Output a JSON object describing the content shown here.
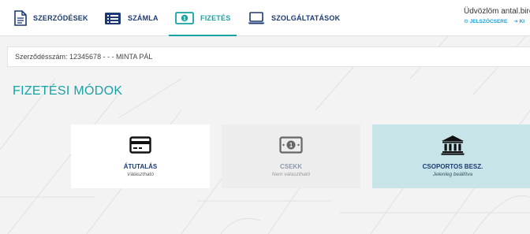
{
  "nav": {
    "items": [
      {
        "label": "SZERZŐDÉSEK",
        "icon": "document-icon"
      },
      {
        "label": "SZÁMLA",
        "icon": "invoice-list-icon"
      },
      {
        "label": "FIZETÉS",
        "icon": "banknote-icon",
        "active": true
      },
      {
        "label": "SZOLGÁLTATÁSOK",
        "icon": "laptop-icon"
      }
    ]
  },
  "user": {
    "greeting": "Üdvözlöm antal.biro",
    "password_change": "JELSZÓCSERE",
    "logout": "KI"
  },
  "contract": {
    "text": "Szerződésszám: 12345678 - - - MINTA PÁL"
  },
  "page": {
    "title": "FIZETÉSI MÓDOK"
  },
  "payment_methods": [
    {
      "title": "ÁTUTALÁS",
      "status": "Választható",
      "icon": "credit-card-icon"
    },
    {
      "title": "CSEKK",
      "status": "Nem választható",
      "icon": "banknote-icon"
    },
    {
      "title": "CSOPORTOS BESZ.",
      "status": "Jelenleg beállítva",
      "icon": "bank-building-icon"
    }
  ],
  "colors": {
    "accent": "#16a3a3",
    "nav_text": "#1b3a73",
    "link": "#1b9ed8",
    "selected_card": "#c7e5e8",
    "disabled_card": "#ededed"
  }
}
